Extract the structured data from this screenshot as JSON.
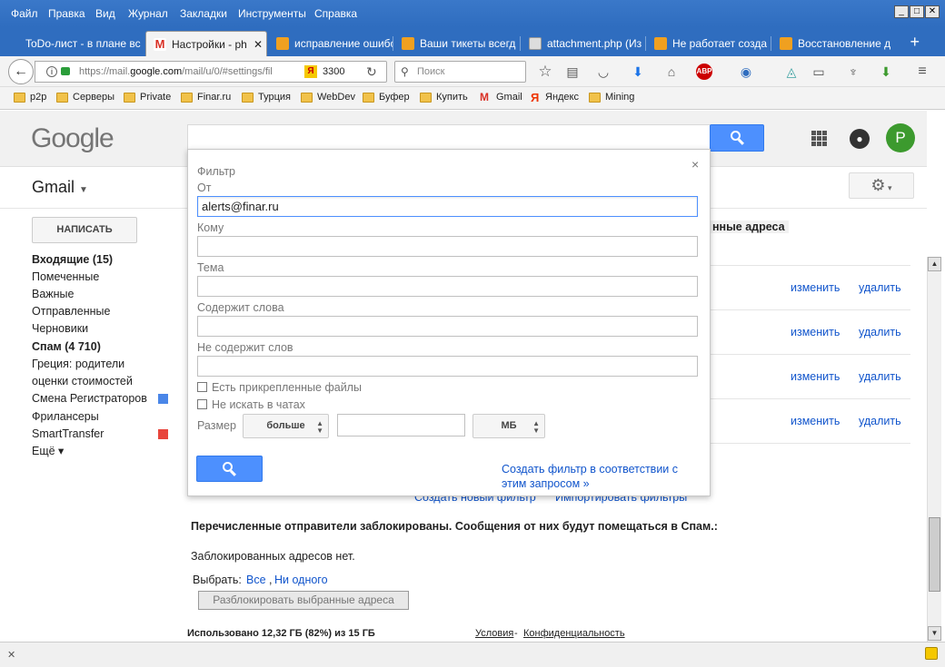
{
  "menubar": {
    "items": [
      "Файл",
      "Правка",
      "Вид",
      "Журнал",
      "Закладки",
      "Инструменты",
      "Справка"
    ],
    "window_controls": [
      "_",
      "□",
      "✕"
    ]
  },
  "tabs": [
    {
      "label": "ToDo-лист - в плане вс",
      "icon_color": "#2f6dbf"
    },
    {
      "label": "Настройки - ph",
      "icon_color": "#d93025",
      "active": true
    },
    {
      "label": "исправление ошибо",
      "icon_color": "#f0a020"
    },
    {
      "label": "Ваши тикеты всегд",
      "icon_color": "#f0a020"
    },
    {
      "label": "attachment.php (Из",
      "icon_color": "#ddd"
    },
    {
      "label": "Не работает созда",
      "icon_color": "#f0a020"
    },
    {
      "label": "Восстановление д",
      "icon_color": "#f0a020"
    }
  ],
  "navbar": {
    "url_prefix": "https://mail.",
    "url_domain": "google.com",
    "url_suffix": "/mail/u/0/#settings/fil",
    "yandex_badge": "Я",
    "yandex_count": "3300",
    "search_placeholder": "Поиск"
  },
  "bookmarks": [
    {
      "label": "p2p",
      "icon": "folder"
    },
    {
      "label": "Серверы",
      "icon": "folder"
    },
    {
      "label": "Private",
      "icon": "folder"
    },
    {
      "label": "Finar.ru",
      "icon": "folder"
    },
    {
      "label": "Турция",
      "icon": "folder"
    },
    {
      "label": "WebDev",
      "icon": "folder"
    },
    {
      "label": "Буфер",
      "icon": "folder"
    },
    {
      "label": "Купить",
      "icon": "folder"
    },
    {
      "label": "Gmail",
      "icon": "gmail"
    },
    {
      "label": "Яндекс",
      "icon": "yandex"
    },
    {
      "label": "Mining",
      "icon": "folder"
    }
  ],
  "header": {
    "logo": "Google",
    "avatar_letter": "P"
  },
  "gmail": {
    "title": "Gmail",
    "compose": "НАПИСАТЬ",
    "nav": [
      {
        "label": "Входящие (15)",
        "bold": true
      },
      {
        "label": "Помеченные"
      },
      {
        "label": "Важные"
      },
      {
        "label": "Отправленные"
      },
      {
        "label": "Черновики"
      },
      {
        "label": "Спам (4 710)",
        "bold": true
      },
      {
        "label": "Греция: родители"
      },
      {
        "label": "оценки стоимостей"
      },
      {
        "label": "Смена Регистраторов",
        "color": "#4a86e8"
      },
      {
        "label": "Фрилансеры"
      },
      {
        "label": "SmartTransfer",
        "color": "#e8453c"
      },
      {
        "label": "Ещё ▾"
      }
    ]
  },
  "main": {
    "partial_heading": "нные адреса",
    "edit_label": "изменить",
    "delete_label": "удалить",
    "create_filter": "Создать новый фильтр",
    "import_filters": "Импортировать фильтры",
    "blocked_title": "Перечисленные отправители заблокированы. Сообщения от них будут помещаться в Спам.:",
    "no_blocked": "Заблокированных адресов нет.",
    "select_label": "Выбрать:",
    "select_all": "Все",
    "select_none": "Ни одного",
    "unblock_button": "Разблокировать выбранные адреса",
    "usage": "Использовано 12,32 ГБ (82%) из 15 ГБ",
    "terms": "Условия",
    "privacy": "Конфиденциальность"
  },
  "filter_popup": {
    "title": "Фильтр",
    "from_label": "От",
    "from_value": "alerts@finar.ru",
    "to_label": "Кому",
    "subject_label": "Тема",
    "has_words_label": "Содержит слова",
    "no_words_label": "Не содержит слов",
    "has_attachment_label": "Есть прикрепленные файлы",
    "no_chats_label": "Не искать в чатах",
    "size_label": "Размер",
    "size_op": "больше",
    "size_unit": "МБ",
    "create_link": "Создать фильтр в соответствии с этим запросом »",
    "close": "×"
  }
}
